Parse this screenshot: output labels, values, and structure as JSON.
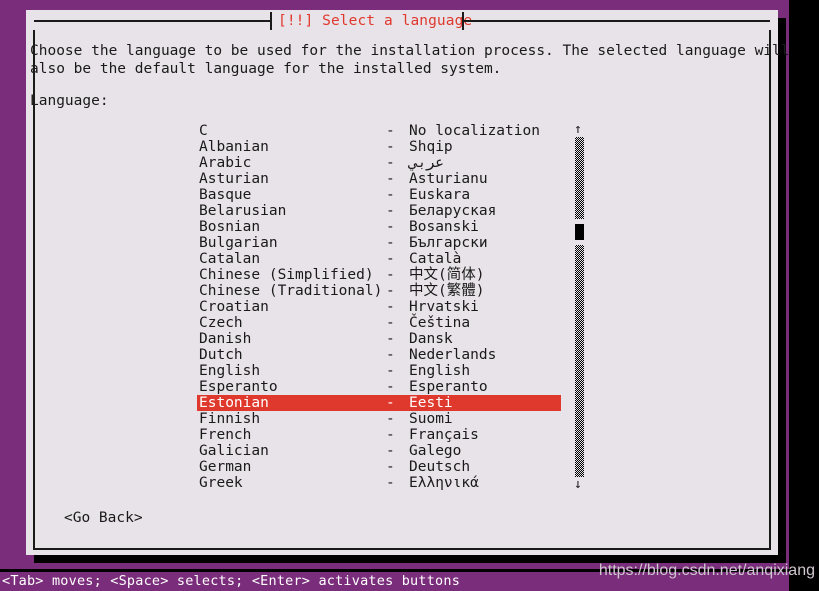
{
  "desktop": {
    "background_color": "#7A2D7A",
    "outer_color": "#000000"
  },
  "dialog": {
    "title": "[!!] Select a language",
    "title_color": "#DF382C",
    "background_color": "#E8E3E8",
    "border_color": "#1A1A1A",
    "description_line1": "Choose the language to be used for the installation process. The selected language will",
    "description_line2": "also be the default language for the installed system.",
    "field_label": "Language:",
    "go_back_label": "<Go Back>"
  },
  "language_list": {
    "selected_index": 17,
    "highlight_color": "#DF382C",
    "highlight_text_color": "#FFFFFF",
    "separator": "-",
    "items": [
      {
        "name": "C",
        "native": "No localization"
      },
      {
        "name": "Albanian",
        "native": "Shqip"
      },
      {
        "name": "Arabic",
        "native": "عربي"
      },
      {
        "name": "Asturian",
        "native": "Asturianu"
      },
      {
        "name": "Basque",
        "native": "Euskara"
      },
      {
        "name": "Belarusian",
        "native": "Беларуская"
      },
      {
        "name": "Bosnian",
        "native": "Bosanski"
      },
      {
        "name": "Bulgarian",
        "native": "Български"
      },
      {
        "name": "Catalan",
        "native": "Català"
      },
      {
        "name": "Chinese (Simplified)",
        "native": "中文(简体)"
      },
      {
        "name": "Chinese (Traditional)",
        "native": "中文(繁體)"
      },
      {
        "name": "Croatian",
        "native": "Hrvatski"
      },
      {
        "name": "Czech",
        "native": "Čeština"
      },
      {
        "name": "Danish",
        "native": "Dansk"
      },
      {
        "name": "Dutch",
        "native": "Nederlands"
      },
      {
        "name": "English",
        "native": "English"
      },
      {
        "name": "Esperanto",
        "native": "Esperanto"
      },
      {
        "name": "Estonian",
        "native": "Eesti"
      },
      {
        "name": "Finnish",
        "native": "Suomi"
      },
      {
        "name": "French",
        "native": "Français"
      },
      {
        "name": "Galician",
        "native": "Galego"
      },
      {
        "name": "German",
        "native": "Deutsch"
      },
      {
        "name": "Greek",
        "native": "Ελληνικά"
      }
    ]
  },
  "scrollbar": {
    "up_arrow": "↑",
    "down_arrow": "↓"
  },
  "status_bar": {
    "text": "<Tab> moves; <Space> selects; <Enter> activates buttons",
    "background_color": "#7A2D7A",
    "text_color": "#FFFFFF"
  },
  "watermark": {
    "text": "https://blog.csdn.net/anqixiang"
  }
}
